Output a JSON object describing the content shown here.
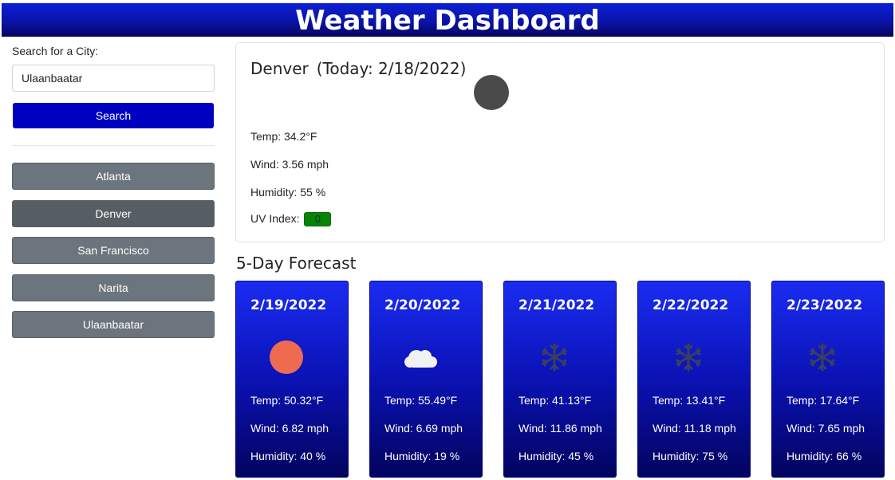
{
  "header": {
    "title": "Weather Dashboard"
  },
  "search": {
    "label": "Search for a City:",
    "value": "Ulaanbaatar",
    "button_label": "Search"
  },
  "history": [
    {
      "label": "Atlanta"
    },
    {
      "label": "Denver"
    },
    {
      "label": "San Francisco"
    },
    {
      "label": "Narita"
    },
    {
      "label": "Ulaanbaatar"
    }
  ],
  "current": {
    "city": "Denver",
    "date": "(Today: 2/18/2022)",
    "icon": "moon-icon",
    "temp": "Temp: 34.2°F",
    "wind": "Wind: 3.56 mph",
    "humidity": "Humidity: 55 %",
    "uv_label": "UV Index:",
    "uv_value": "0",
    "uv_color": "#078407"
  },
  "forecast": {
    "heading": "5-Day Forecast",
    "days": [
      {
        "date": "2/19/2022",
        "icon": "sun-icon",
        "temp": "Temp: 50.32°F",
        "wind": "Wind: 6.82 mph",
        "humidity": "Humidity: 40 %"
      },
      {
        "date": "2/20/2022",
        "icon": "cloud-icon",
        "temp": "Temp: 55.49°F",
        "wind": "Wind: 6.69 mph",
        "humidity": "Humidity: 19 %"
      },
      {
        "date": "2/21/2022",
        "icon": "snowflake-icon",
        "temp": "Temp: 41.13°F",
        "wind": "Wind: 11.86 mph",
        "humidity": "Humidity: 45 %"
      },
      {
        "date": "2/22/2022",
        "icon": "snowflake-icon",
        "temp": "Temp: 13.41°F",
        "wind": "Wind: 11.18 mph",
        "humidity": "Humidity: 75 %"
      },
      {
        "date": "2/23/2022",
        "icon": "snowflake-icon",
        "temp": "Temp: 17.64°F",
        "wind": "Wind: 7.65 mph",
        "humidity": "Humidity: 66 %"
      }
    ]
  },
  "colors": {
    "header_blue": "#0a14a8",
    "search_button": "#0000c0",
    "history_button": "#6c757d",
    "history_active": "#565e64"
  }
}
